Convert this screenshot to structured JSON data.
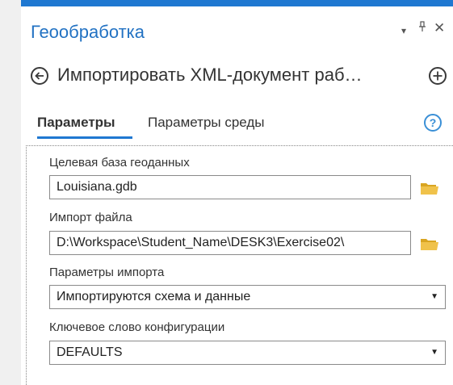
{
  "panel": {
    "title": "Геообработка",
    "controls": {
      "dropdown": "▾",
      "pin": "ɨ",
      "close": "✕"
    }
  },
  "tool": {
    "title": "Импортировать XML-документ раб…",
    "back_icon": "arrow-left-icon",
    "add_icon": "plus-icon"
  },
  "tabs": [
    {
      "label": "Параметры",
      "active": true
    },
    {
      "label": "Параметры среды",
      "active": false
    }
  ],
  "help_label": "?",
  "params": [
    {
      "label": "Целевая база геоданных",
      "value": "Louisiana.gdb",
      "kind": "text",
      "browse_icon": "folder-icon"
    },
    {
      "label": "Импорт файла",
      "value": "D:\\Workspace\\Student_Name\\DESK3\\Exercise02\\",
      "kind": "text",
      "browse_icon": "folder-icon"
    },
    {
      "label": "Параметры импорта",
      "value": "Импортируются схема и данные",
      "kind": "select"
    },
    {
      "label": "Ключевое слово конфигурации",
      "value": "DEFAULTS",
      "kind": "select"
    }
  ],
  "colors": {
    "accent": "#1f78d1",
    "title": "#2272c3",
    "folder": "#e8b730"
  }
}
